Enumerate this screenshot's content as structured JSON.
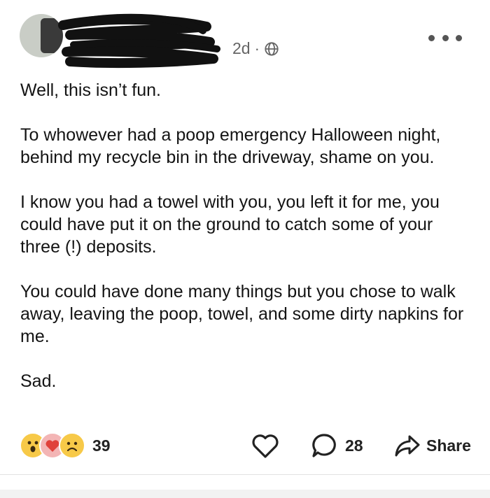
{
  "post": {
    "timestamp": "2d",
    "separator": "·",
    "privacy_icon": "globe-icon",
    "more_icon": "more-horizontal-icon",
    "paragraphs": [
      "Well, this isn’t fun.",
      "To whowever had a poop emergency Halloween night, behind my recycle bin in the driveway, shame on you.",
      "I know you had a towel with you, you left it for me, you could have put it on the ground to catch some of your three (!) deposits.",
      "You could have done many things but you chose to walk away, leaving the poop, towel, and some dirty napkins for me.",
      "Sad."
    ]
  },
  "reactions": {
    "icons": [
      "wow-emoji",
      "heart-emoji",
      "sad-emoji"
    ],
    "count": "39"
  },
  "actions": {
    "like_icon": "heart-outline-icon",
    "comment_icon": "speech-bubble-icon",
    "comment_count": "28",
    "share_icon": "share-arrow-icon",
    "share_label": "Share"
  },
  "colors": {
    "text": "#141414",
    "meta": "#666666",
    "wow": "#f7c948",
    "heart": "#e0413b"
  }
}
